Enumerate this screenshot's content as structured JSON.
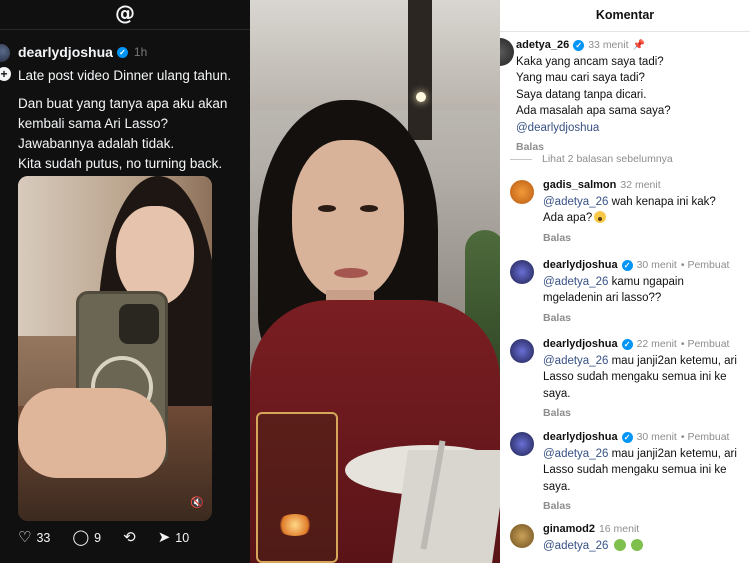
{
  "threads": {
    "logo_icon": "threads-logo-icon",
    "username": "dearlydjoshua",
    "time": "1h",
    "lines": [
      "Late post video Dinner ulang tahun.",
      "Dan buat yang tanya apa aku akan",
      "kembali sama Ari Lasso?",
      "Jawabannya adalah tidak.",
      "Kita sudah putus, no turning back."
    ],
    "mute_icon": "speaker-muted-icon",
    "actions": {
      "likes": "33",
      "comments": "9",
      "shares": "10"
    }
  },
  "comments": {
    "title": "Komentar",
    "reply_label": "Balas",
    "view_more": "Lihat 2 balasan sebelumnya",
    "items": [
      {
        "user": "adetya_26",
        "verified": true,
        "meta": "33 menit",
        "pinned": true,
        "lines": [
          "Kaka yang ancam saya tadi?",
          "Yang mau cari saya tadi?",
          "Saya datang tanpa dicari.",
          "Ada masalah apa sama saya?"
        ],
        "mention_line": "@dearlydjoshua"
      },
      {
        "user": "gadis_salmon",
        "meta": "32 menit",
        "mention": "@adetya_26",
        "lines": [
          "wah kenapa ini kak?",
          "Ada apa?"
        ]
      },
      {
        "user": "dearlydjoshua",
        "verified": true,
        "meta": "30 menit",
        "creator": "• Pembuat",
        "mention": "@adetya_26",
        "lines": [
          "kamu ngapain",
          "mgeladenin ari lasso??"
        ]
      },
      {
        "user": "dearlydjoshua",
        "verified": true,
        "meta": "22 menit",
        "creator": "• Pembuat",
        "mention": "@adetya_26",
        "lines": [
          "mau janji2an ketemu, ari",
          "Lasso sudah mengaku semua ini ke",
          "saya."
        ]
      },
      {
        "user": "dearlydjoshua",
        "verified": true,
        "meta": "30 menit",
        "creator": "• Pembuat",
        "mention": "@adetya_26",
        "lines": [
          "mau janji2an ketemu, ari",
          "Lasso sudah mengaku semua ini ke",
          "saya."
        ]
      },
      {
        "user": "ginamod2",
        "meta": "16 menit",
        "mention": "@adetya_26"
      }
    ]
  }
}
